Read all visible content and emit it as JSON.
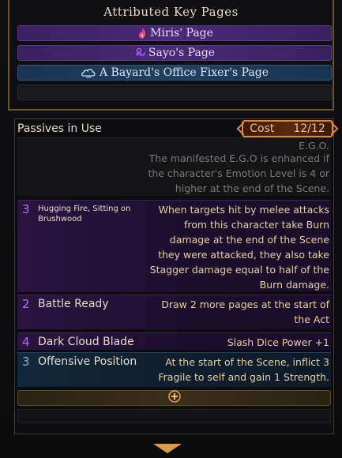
{
  "header": {
    "title": "Attributed Key Pages"
  },
  "key_pages": [
    {
      "label": "Miris' Page",
      "icon": "flame-icon"
    },
    {
      "label": "Sayo's Page",
      "icon": "smoke-swirl-icon"
    },
    {
      "label": "A Bayard's Office Fixer's Page",
      "icon": "cloud-icon"
    }
  ],
  "passives": {
    "header": "Passives in Use",
    "cost_label": "Cost",
    "cost_value": "12/12",
    "ego_title": "E.G.O.",
    "ego_desc": "The manifested E.G.O is enhanced if the character's Emotion Level is 4 or higher at the end of the Scene.",
    "items": [
      {
        "cost": "3",
        "name": "Hugging Fire, Sitting on Brushwood",
        "desc": "When targets hit by melee attacks from this character take Burn damage at the end of the Scene they were attacked, they also take Stagger damage equal to half of the Burn damage."
      },
      {
        "cost": "2",
        "name": "Battle Ready",
        "desc": "Draw 2 more pages at the start of the Act"
      },
      {
        "cost": "4",
        "name": "Dark Cloud Blade",
        "desc": "Slash Dice Power +1"
      },
      {
        "cost": "3",
        "name": "Offensive Position",
        "desc": "At the start of the Scene, inflict 3 Fragile to self and gain 1 Strength."
      }
    ]
  },
  "colors": {
    "purple_cost": "#b06cff",
    "blue_cost": "#7fb0e0",
    "gold": "#e0a048",
    "desc_text": "#e8cfa0"
  }
}
